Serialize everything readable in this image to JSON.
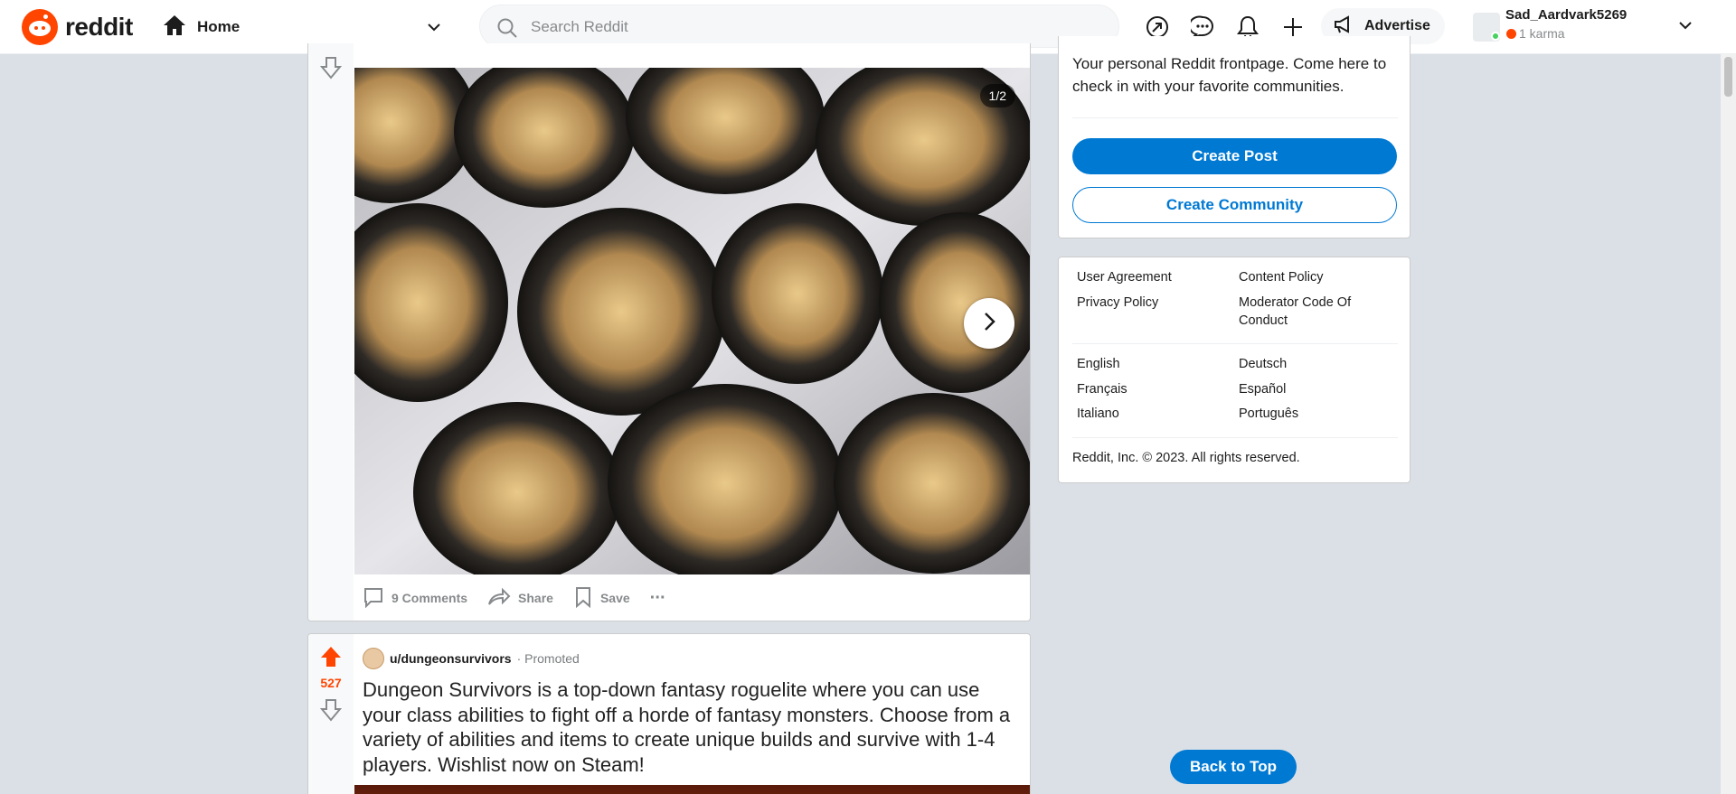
{
  "header": {
    "logo_text": "reddit",
    "home_label": "Home",
    "search_placeholder": "Search Reddit",
    "advertise_label": "Advertise",
    "username": "Sad_Aardvark5269",
    "karma": "1 karma"
  },
  "post1": {
    "gallery_counter": "1/2",
    "actions": {
      "comments": "9 Comments",
      "share": "Share",
      "save": "Save",
      "more": "···"
    }
  },
  "post2": {
    "score": "527",
    "author": "u/dungeonsurvivors",
    "promoted": "· Promoted",
    "title": "Dungeon Survivors is a top-down fantasy roguelite where you can use your class abilities to fight off a horde of fantasy monsters. Choose from a variety of abilities and items to create unique builds and survive with 1-4 players. Wishlist now on Steam!"
  },
  "sidebar": {
    "home_description": "Your personal Reddit frontpage. Come here to check in with your favorite communities.",
    "create_post": "Create Post",
    "create_community": "Create Community",
    "links": {
      "user_agreement": "User Agreement",
      "content_policy": "Content Policy",
      "privacy_policy": "Privacy Policy",
      "moderator_code": "Moderator Code Of Conduct"
    },
    "languages": {
      "english": "English",
      "deutsch": "Deutsch",
      "francais": "Français",
      "espanol": "Español",
      "italiano": "Italiano",
      "portugues": "Português"
    },
    "copyright": "Reddit, Inc. © 2023. All rights reserved."
  },
  "back_to_top": "Back to Top",
  "colors": {
    "brand": "#ff4500",
    "primary": "#0079d3",
    "background": "#dae0e6"
  }
}
